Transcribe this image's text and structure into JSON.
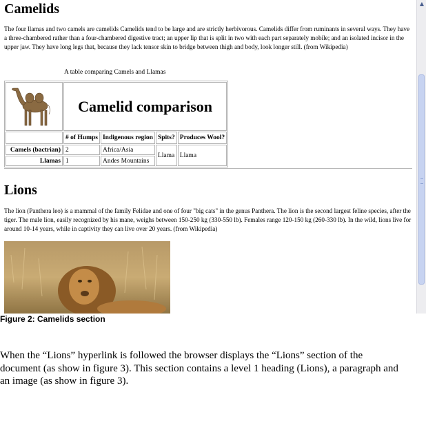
{
  "browser": {
    "camelids": {
      "heading": "Camelids",
      "paragraph": "The four llamas and two camels are camelids Camelids tend to be large and are strictly herbivorous. Camelids differ from ruminants in several ways. They have a three-chambered rather than a four-chambered digestive tract; an upper lip that is split in two with each part separately mobile; and an isolated incisor in the upper jaw. They have long legs that, because they lack tensor skin to bridge between thigh and body, look longer still. (from Wikipedia)",
      "table": {
        "caption": "A table comparing Camels and Llamas",
        "title": "Camelid comparison",
        "columns": [
          "# of Humps",
          "Indigenous region",
          "Spits?",
          "Produces Wool?"
        ],
        "rows": [
          {
            "name": "Camels (bactrian)",
            "humps": "2",
            "region": "Africa/Asia"
          },
          {
            "name": "Llamas",
            "humps": "1",
            "region": "Andes Mountains"
          }
        ],
        "spits_shared": "Llama",
        "wool_shared": "Llama"
      }
    },
    "lions": {
      "heading": "Lions",
      "paragraph": "The lion (Panthera leo) is a mammal of the family Felidae and one of four \"big cats\" in the genus Panthera. The lion is the second largest feline species, after the tiger. The male lion, easily recognized by his mane, weighs between 150-250 kg (330-550 lb). Females range 120-150 kg (260-330 lb). In the wild, lions live for around 10-14 years, while in captivity they can live over 20 years. (from Wikipedia)"
    },
    "scrollbar": {
      "up_arrow_icon": "chevron-up-icon",
      "thumb_color": "#c7d3f1"
    }
  },
  "figure_caption": "Figure 2: Camelids section",
  "body_lines": [
    "When the “Lions” hyperlink is followed the browser displays the “Lions” section of the",
    "document (as show in figure 3). This section contains a level 1 heading (Lions), a paragraph and",
    "an image (as show in figure 3)."
  ]
}
